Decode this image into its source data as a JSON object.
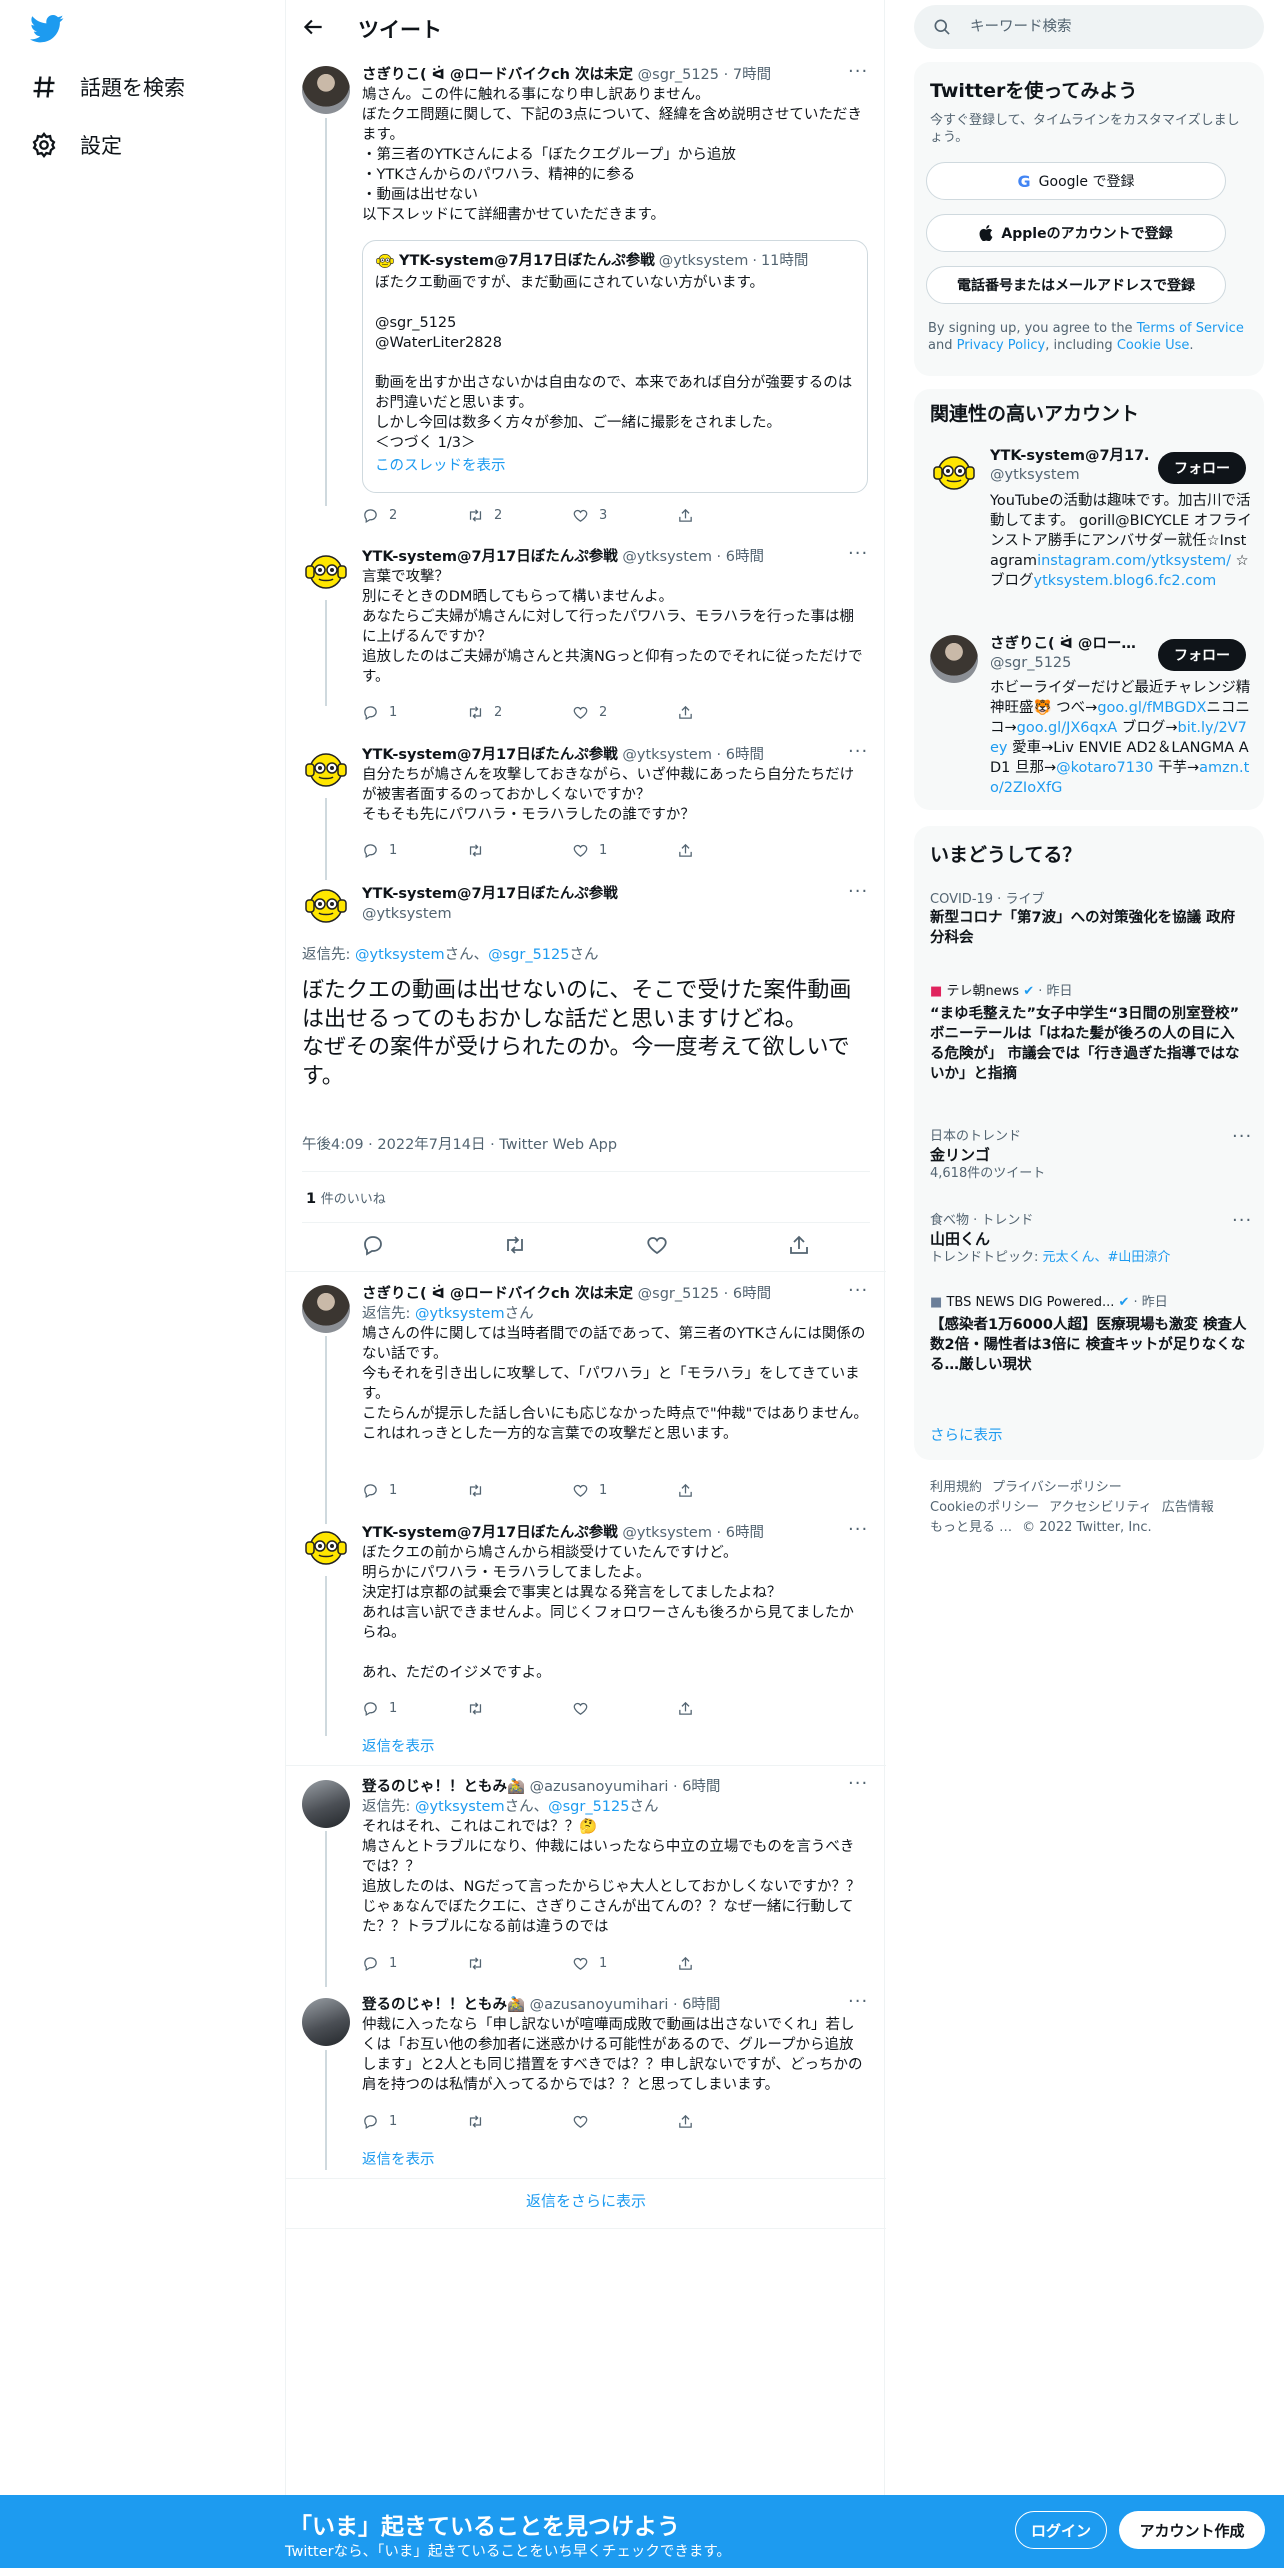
{
  "nav": {
    "items": [
      {
        "label": "話題を検索",
        "icon": "hashtag-icon"
      },
      {
        "label": "設定",
        "icon": "gear-icon"
      }
    ]
  },
  "header": {
    "title": "ツイート"
  },
  "tweets": [
    {
      "name": "さぎりこ( ᐛ @ロードバイクch 次は未定",
      "handle": "@sgr_5125",
      "time": "7時間",
      "text": "鳩さん。この件に触れる事になり申し訳ありません。\nぼたクエ問題に関して、下記の3点について、経緯を含め説明させていただきます。\n・第三者のYTKさんによる「ぼたクエグループ」から追放\n・YTKさんからのパワハラ、精神的に参る\n・動画は出せない\n以下スレッドにて詳細書かせていただきます。",
      "quote": {
        "name": "YTK-system@7月17日ぼたんぷ参戦",
        "handle": "@ytksystem",
        "time": "11時間",
        "text": "ぼたクエ動画ですが、まだ動画にされていない方がいます。\n\n@sgr_5125\n@WaterLiter2828\n\n動画を出すか出さないかは自由なので、本来であれば自分が強要するのはお門違いだと思います。\nしかし今回は数多く方々が参加、ご一緒に撮影をされました。\n＜つづく 1/3＞",
        "show_thread": "このスレッドを表示"
      },
      "replies": "2",
      "retweets": "2",
      "likes": "3"
    },
    {
      "name": "YTK-system@7月17日ぼたんぷ参戦",
      "handle": "@ytksystem",
      "time": "6時間",
      "text": "言葉で攻撃？\n別にそときのDM晒してもらって構いませんよ。\nあなたらご夫婦が鳩さんに対して行ったパワハラ、モラハラを行った事は棚に上げるんですか？\n追放したのはご夫婦が鳩さんと共演NGっと仰有ったのでそれに従っただけです。",
      "replies": "1",
      "retweets": "2",
      "likes": "2"
    },
    {
      "name": "YTK-system@7月17日ぼたんぷ参戦",
      "handle": "@ytksystem",
      "time": "6時間",
      "text": "自分たちが鳩さんを攻撃しておきながら、いざ仲裁にあったら自分たちだけが被害者面するのっておかしくないですか？\nそもそも先にパワハラ・モラハラしたの誰ですか？",
      "replies": "1",
      "retweets": "",
      "likes": "1"
    }
  ],
  "main_tweet": {
    "name": "YTK-system@7月17日ぼたんぷ参戦",
    "handle": "@ytksystem",
    "reply_prefix": "返信先: ",
    "reply_to_1": "@ytksystem",
    "reply_mid": "さん、",
    "reply_to_2": "@sgr_5125",
    "reply_suffix": "さん",
    "text": "ぼたクエの動画は出せないのに、そこで受けた案件動画は出せるってのもおかしな話だと思いますけどね。\nなぜその案件が受けられたのか。今一度考えて欲しいです。",
    "timestamp": "午後4:09 · 2022年7月14日 · Twitter Web App",
    "like_count": "1",
    "like_label": "件のいいね"
  },
  "replies": [
    {
      "name": "さぎりこ( ᐛ @ロードバイクch 次は未定",
      "handle": "@sgr_5125",
      "time": "6時間",
      "reply_prefix": "返信先: ",
      "reply_to": "@ytksystem",
      "reply_suffix": "さん",
      "text": "鳩さんの件に関しては当時者間での話であって、第三者のYTKさんには関係のない話です。\n今もそれを引き出しに攻撃して、「パワハラ」と「モラハラ」をしてきています。\nこたらんが提示した話し合いにも応じなかった時点で\"仲裁\"ではありません。\nこれはれっきとした一方的な言葉での攻撃だと思います。",
      "replies": "1",
      "retweets": "",
      "likes": "1"
    },
    {
      "name": "YTK-system@7月17日ぼたんぷ参戦",
      "handle": "@ytksystem",
      "time": "6時間",
      "text": "ぼたクエの前から鳩さんから相談受けていたんですけど。\n明らかにパワハラ・モラハラしてましたよ。\n決定打は京都の試乗会で事実とは異なる発言をしてましたよね？\nあれは言い訳できませんよ。同じくフォロワーさんも後ろから見てましたからね。\n\nあれ、ただのイジメですよ。",
      "replies": "1",
      "retweets": "",
      "likes": "",
      "show_replies": "返信を表示"
    },
    {
      "name": "登るのじゃ！！ともみ🚵",
      "handle": "@azusanoyumihari",
      "time": "6時間",
      "reply_prefix": "返信先: ",
      "reply_to": "@ytksystem",
      "reply_mid": "さん、",
      "reply_to_2": "@sgr_5125",
      "reply_suffix": "さん",
      "text": "それはそれ、これはこれでは？？🤔\n鳩さんとトラブルになり、仲裁にはいったなら中立の立場でものを言うべきでは？？\n追放したのは、NGだって言ったからじゃ大人としておかしくないですか？？じゃぁなんでぼたクエに、さぎりこさんが出てんの？？なぜ一緒に行動してた？？トラブルになる前は違うのでは",
      "replies": "1",
      "retweets": "",
      "likes": "1"
    },
    {
      "name": "登るのじゃ！！ともみ🚵",
      "handle": "@azusanoyumihari",
      "time": "6時間",
      "text": "仲裁に入ったなら「申し訳ないが喧嘩両成敗で動画は出さないでくれ」若しくは「お互い他の参加者に迷惑かける可能性があるので、グループから追放します」と2人とも同じ措置をすべきでは？？申し訳ないですが、どっちかの肩を持つのは私情が入ってるからでは？？と思ってしまいます。",
      "replies": "1",
      "retweets": "",
      "likes": "",
      "show_replies": "返信を表示"
    }
  ],
  "show_more_replies": "返信をさらに表示",
  "sidebar": {
    "search_placeholder": "キーワード検索",
    "signup_card": {
      "title": "Twitterを使ってみよう",
      "subtitle": "今すぐ登録して、タイムラインをカスタマイズしましょう。",
      "google": "Google で登録",
      "apple": "Appleのアカウントで登録",
      "phone": "電話番号またはメールアドレスで登録",
      "terms_pre": "By signing up, you agree to the ",
      "terms_link": "Terms of Service",
      "terms_and": " and ",
      "privacy_link": "Privacy Policy",
      "terms_including": ", including ",
      "cookie_link": "Cookie Use",
      "terms_end": "."
    },
    "related": {
      "title": "関連性の高いアカウント",
      "follow_label": "フォロー",
      "accounts": [
        {
          "name": "YTK-system@7月17…",
          "handle": "@ytksystem",
          "bio_1": "YouTubeの活動は趣味です。加古川で活動してます。 gorill@BICYCLE オフラインストア勝手にアンバサダー就任☆Instagram",
          "bio_link_1": "instagram.com/ytksystem/",
          "bio_2": " ☆ブログ",
          "bio_link_2": "ytksystem.blog6.fc2.com"
        },
        {
          "name": "さぎりこ( ᐛ @ロー…",
          "handle": "@sgr_5125",
          "bio_1": "ホビーライダーだけど最近チャレンジ精神旺盛🐯 つべ→",
          "bio_link_1": "goo.gl/fMBGDX",
          "bio_2": "ニコニコ→",
          "bio_link_2": "goo.gl/JX6qxA",
          "bio_3": " ブログ→",
          "bio_link_3": "bit.ly/2V7ey",
          "bio_4": " 愛車→Liv ENVIE AD2＆LANGMA AD1 旦那→",
          "bio_link_4": "@kotaro7130",
          "bio_5": " 干芋→",
          "bio_link_5": "amzn.to/2ZIoXfG"
        }
      ]
    },
    "trends": {
      "title": "いまどうしてる？",
      "items": [
        {
          "category": "COVID-19 · ライブ",
          "headline": "新型コロナ「第7波」への対策強化を協議 政府分科会"
        },
        {
          "source": "テレ朝news",
          "time": "· 昨日",
          "headline": "“まゆ毛整えた”女子中学生“3日間の別室登校” ボニーテールは「はねた髪が後ろの人の目に入る危険が」 市議会では「行き過ぎた指導ではないか」と指摘"
        },
        {
          "category": "日本のトレンド",
          "headline": "金リンゴ",
          "sub": "4,618件のツイート"
        },
        {
          "category": "食べ物 · トレンド",
          "headline": "山田くん",
          "sub_pre": "トレンドトピック: ",
          "sub_link": "元太くん、#山田涼介"
        },
        {
          "source": "TBS NEWS DIG Powered...",
          "time": "· 昨日",
          "headline": "【感染者1万6000人超】医療現場も激変 検査人数2倍・陽性者は3倍に 検査キットが足りなくなる…厳しい現状"
        }
      ],
      "show_more": "さらに表示"
    },
    "footer": [
      "利用規約",
      "プライバシーポリシー",
      "Cookieのポリシー",
      "アクセシビリティ",
      "広告情報",
      "もっと見る …",
      "© 2022 Twitter, Inc."
    ]
  },
  "bottom_bar": {
    "title": "「いま」起きていることを見つけよう",
    "subtitle": "Twitterなら、「いま」起きていることをいち早くチェックできます。",
    "login": "ログイン",
    "signup": "アカウント作成"
  },
  "colors": {
    "accent": "#1d9bf0",
    "text": "#0f1419",
    "muted": "#536471",
    "border": "#eff3f4"
  }
}
